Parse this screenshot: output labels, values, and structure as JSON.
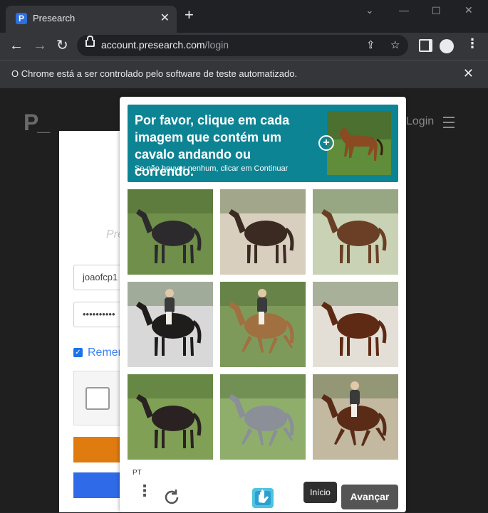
{
  "browser": {
    "tab_title": "Presearch",
    "tab_favicon_letter": "P",
    "url_host": "account.presearch.com",
    "url_path": "/login",
    "infobar_text": "O Chrome está a ser controlado pelo software de teste automatizado."
  },
  "page": {
    "logo_text": "P_",
    "login_link": "Login",
    "heading_fragment": "Pre",
    "username_value": "joaofcp1",
    "password_value": "••••••••••",
    "remember_label": "Remem"
  },
  "captcha": {
    "prompt_title": "Por favor, clique em cada imagem que contém um cavalo andando ou correndo.",
    "prompt_subtitle": "Se não houver nenhum, clicar em Continuar",
    "language": "PT",
    "start_button": "Início",
    "next_button": "Avançar",
    "tiles": [
      {
        "label": "dark bay horse standing",
        "bg": "#6f8f4a",
        "horse": "#2c2a2c",
        "rider": false,
        "moving": false
      },
      {
        "label": "dark bay horse on sand",
        "bg": "#d9cfbf",
        "horse": "#3a2a22",
        "rider": false,
        "moving": false
      },
      {
        "label": "bay horse standing",
        "bg": "#c9d2b4",
        "horse": "#6a3f25",
        "rider": false,
        "moving": false
      },
      {
        "label": "horse with rider standing",
        "bg": "#d8d8d8",
        "horse": "#1f1c1c",
        "rider": true,
        "moving": false
      },
      {
        "label": "buckskin horse trotting with rider",
        "bg": "#7e9a5a",
        "horse": "#a07040",
        "rider": true,
        "moving": true
      },
      {
        "label": "chestnut horse standing",
        "bg": "#e4dfd6",
        "horse": "#5e2a14",
        "rider": false,
        "moving": false
      },
      {
        "label": "dark horse standing on grass",
        "bg": "#7fa055",
        "horse": "#2a2222",
        "rider": false,
        "moving": false
      },
      {
        "label": "grey horse galloping",
        "bg": "#8fae6c",
        "horse": "#8a8f98",
        "rider": false,
        "moving": true
      },
      {
        "label": "bay horse cantering with rider",
        "bg": "#c3b8a0",
        "horse": "#5a2c18",
        "rider": true,
        "moving": true
      }
    ]
  }
}
